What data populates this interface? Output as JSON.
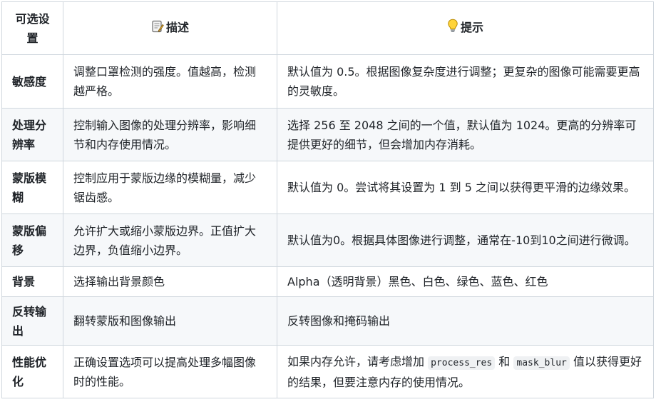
{
  "header": {
    "option": "可选设置",
    "description": "描述",
    "hint": "提示"
  },
  "icons": {
    "description": "memo-icon",
    "hint": "light-bulb-icon"
  },
  "rows": [
    {
      "option": "敏感度",
      "description": "调整口罩检测的强度。值越高，检测越严格。",
      "hint": "默认值为 0.5。根据图像复杂度进行调整；更复杂的图像可能需要更高的灵敏度。"
    },
    {
      "option": "处理分辨率",
      "description": "控制输入图像的处理分辨率，影响细节和内存使用情况。",
      "hint": "选择 256 至 2048 之间的一个值，默认值为 1024。更高的分辨率可提供更好的细节，但会增加内存消耗。"
    },
    {
      "option": "蒙版模糊",
      "description": "控制应用于蒙版边缘的模糊量，减少锯齿感。",
      "hint": "默认值为 0。尝试将其设置为 1 到 5 之间以获得更平滑的边缘效果。"
    },
    {
      "option": "蒙版偏移",
      "description": "允许扩大或缩小蒙版边界。正值扩大边界，负值缩小边界。",
      "hint": "默认值为0。根据具体图像进行调整，通常在-10到10之间进行微调。"
    },
    {
      "option": "背景",
      "description": "选择输出背景颜色",
      "hint": "Alpha（透明背景）黑色、白色、绿色、蓝色、红色"
    },
    {
      "option": "反转输出",
      "description": "翻转蒙版和图像输出",
      "hint": "反转图像和掩码输出"
    },
    {
      "option": "性能优化",
      "description": "正确设置选项可以提高处理多幅图像时的性能。",
      "hint_parts": {
        "before": "如果内存允许，请考虑增加",
        "code1": "process_res",
        "middle": "和",
        "code2": "mask_blur",
        "after": "值以获得更好的结果，但要注意内存的使用情况。"
      }
    }
  ]
}
